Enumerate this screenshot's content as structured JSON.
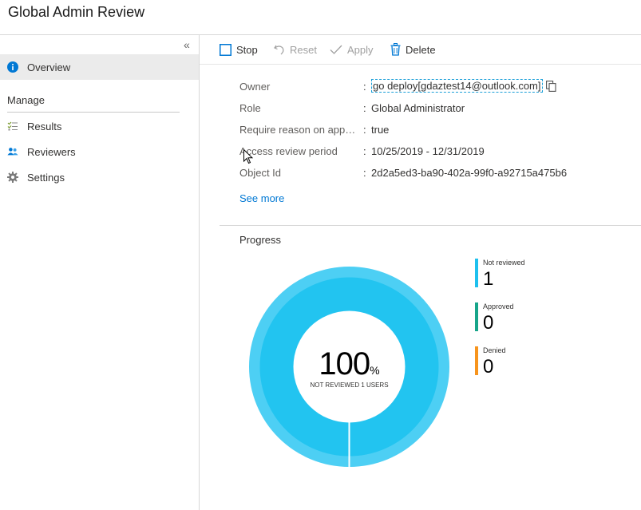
{
  "page": {
    "title": "Global Admin Review"
  },
  "sidebar": {
    "collapse_glyph": "«",
    "section_label": "Manage",
    "items": [
      {
        "label": "Overview",
        "icon": "info-icon",
        "active": true
      },
      {
        "label": "Results",
        "icon": "checklist-icon",
        "active": false
      },
      {
        "label": "Reviewers",
        "icon": "people-icon",
        "active": false
      },
      {
        "label": "Settings",
        "icon": "gear-icon",
        "active": false
      }
    ]
  },
  "toolbar": {
    "stop_label": "Stop",
    "reset_label": "Reset",
    "apply_label": "Apply",
    "delete_label": "Delete"
  },
  "properties": [
    {
      "label": "Owner",
      "value": "go deploy[gdaztest14@outlook.com]"
    },
    {
      "label": "Role",
      "value": "Global Administrator"
    },
    {
      "label": "Require reason on approval",
      "value": "true"
    },
    {
      "label": "Access review period",
      "value": "10/25/2019 - 12/31/2019"
    },
    {
      "label": "Object Id",
      "value": "2d2a5ed3-ba90-402a-99f0-a92715a475b6"
    }
  ],
  "see_more": "See more",
  "progress": {
    "title": "Progress",
    "percent": "100",
    "percent_sign": "%",
    "center_label": "NOT REVIEWED 1 USERS",
    "legend": [
      {
        "name": "Not reviewed",
        "value": "1",
        "color": "#1ec0ee"
      },
      {
        "name": "Approved",
        "value": "0",
        "color": "#17a58a"
      },
      {
        "name": "Denied",
        "value": "0",
        "color": "#f7941d"
      }
    ]
  },
  "colors": {
    "accent": "#0078d4",
    "donut_outer": "#4dcff4",
    "donut_inner": "#22c4f0"
  }
}
